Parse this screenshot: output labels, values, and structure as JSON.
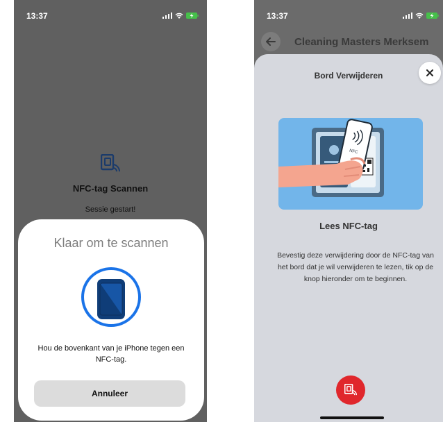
{
  "colors": {
    "accent_red": "#e0272c",
    "nfc_blue": "#1a73e8",
    "modal_bg": "#d6d8de",
    "dim_bg": "#606060"
  },
  "left_screen": {
    "status": {
      "time": "13:37"
    },
    "background": {
      "logo_icon": "nfc-logo-icon",
      "title": "NFC-tag Scannen",
      "subtitle": "Sessie gestart!"
    },
    "scan_sheet": {
      "title": "Klaar om te scannen",
      "icon": "phone-scan-icon",
      "instruction": "Hou de bovenkant van je iPhone tegen een NFC-tag.",
      "cancel_label": "Annuleer"
    }
  },
  "right_screen": {
    "status": {
      "time": "13:37"
    },
    "header": {
      "back_icon": "back-arrow-icon",
      "title": "Cleaning Masters Merksem"
    },
    "modal": {
      "title": "Bord Verwijderen",
      "close_icon": "close-icon",
      "illustration": "nfc-tap-illustration",
      "heading": "Lees NFC-tag",
      "description": "Bevestig deze verwijdering door de NFC-tag van het bord dat je wil verwijderen te lezen, tik op de knop hieronder om te beginnen.",
      "scan_button_icon": "nfc-scan-icon"
    }
  }
}
